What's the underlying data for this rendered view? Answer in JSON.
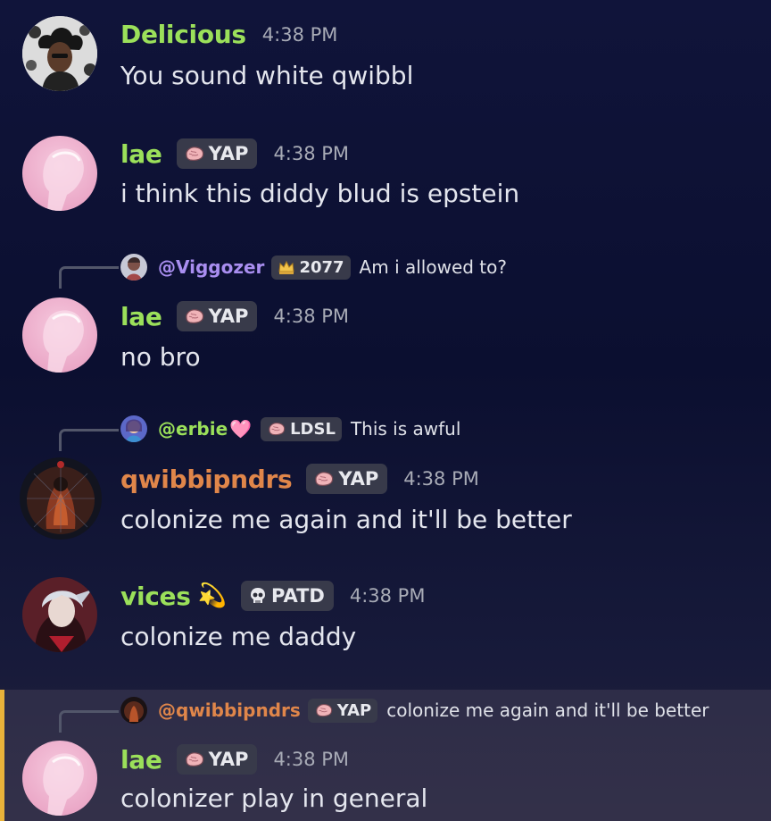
{
  "colors": {
    "green_name": "#9be05a",
    "orange_name": "#e0864a",
    "purple_mention": "#a98ef0",
    "gold_highlight": "#e9b23a",
    "tag_bg": "#383a4a"
  },
  "messages": [
    {
      "author": "Delicious",
      "time": "4:38 PM",
      "text": "You sound white qwibbl",
      "tag": null
    },
    {
      "author": "lae",
      "tag_icon": "pink-brain-icon",
      "tag": "YAP",
      "time": "4:38 PM",
      "text": "i think this diddy blud is epstein"
    },
    {
      "reply": {
        "mention": "@Viggozer",
        "tag_icon": "gold-crown-icon",
        "tag": "2077",
        "text": "Am i allowed to?"
      },
      "author": "lae",
      "tag": "YAP",
      "time": "4:38 PM",
      "text": "no bro"
    },
    {
      "reply": {
        "mention": "@erbie",
        "emoji": "🩷",
        "tag": "LDSL",
        "text": "This is awful"
      },
      "author": "qwibbipndrs",
      "tag": "YAP",
      "time": "4:38 PM",
      "text": "colonize me again and it'll be better"
    },
    {
      "author": "vices",
      "emoji": "💫",
      "tag_icon": "skull-icon",
      "tag": "PATD",
      "time": "4:38 PM",
      "text": "colonize me daddy"
    },
    {
      "reply": {
        "mention": "@qwibbipndrs",
        "tag": "YAP",
        "text": "colonize me again and it'll be better"
      },
      "author": "lae",
      "tag": "YAP",
      "time": "4:38 PM",
      "text": "colonizer play in general"
    }
  ]
}
